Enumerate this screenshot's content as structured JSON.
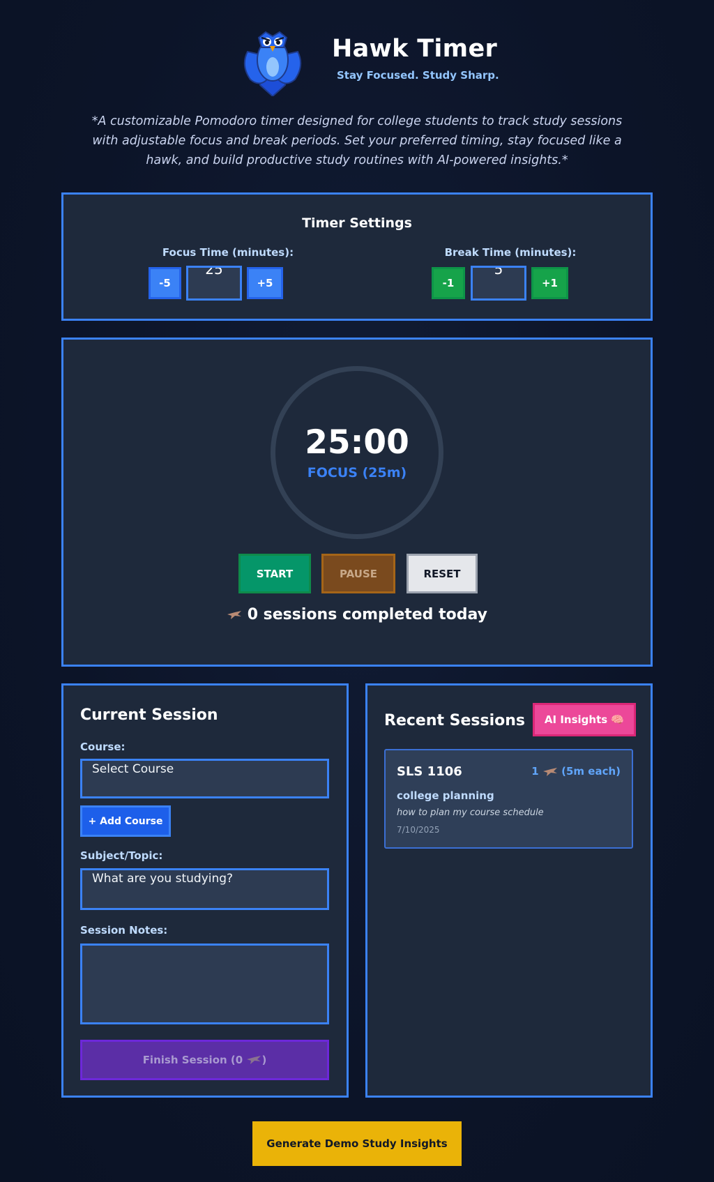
{
  "app": {
    "title": "Hawk Timer",
    "tagline": "Stay Focused. Study Sharp.",
    "intro": "*A customizable Pomodoro timer designed for college students to track study sessions with adjustable focus and break periods. Set your preferred timing, stay focused like a hawk, and build productive study routines with AI-powered insights.*"
  },
  "settings": {
    "title": "Timer Settings",
    "focus_label": "Focus Time (minutes):",
    "focus_minus": "-5",
    "focus_value": "25",
    "focus_plus": "+5",
    "break_label": "Break Time (minutes):",
    "break_minus": "-1",
    "break_value": "5",
    "break_plus": "+1"
  },
  "timer": {
    "time": "25:00",
    "mode": "FOCUS (25m)",
    "start": "START",
    "pause": "PAUSE",
    "reset": "RESET",
    "sessions_text": "0 sessions completed today"
  },
  "current_session": {
    "title": "Current Session",
    "course_label": "Course:",
    "course_placeholder": "Select Course",
    "add_course": "+ Add Course",
    "subject_label": "Subject/Topic:",
    "subject_placeholder": "What are you studying?",
    "notes_label": "Session Notes:",
    "finish_prefix": "Finish Session (0",
    "finish_suffix": ")"
  },
  "recent_sessions": {
    "title": "Recent Sessions",
    "ai_button": "AI Insights 🧠",
    "items": [
      {
        "course": "SLS 1106",
        "count_num": "1",
        "count_suffix": "(5m each)",
        "topic": "college planning",
        "note": "how to plan my course schedule",
        "date": "7/10/2025"
      }
    ]
  },
  "footer": {
    "demo_button": "Generate Demo Study Insights"
  },
  "colors": {
    "accent": "#3b82f6",
    "panel": "#1e293b",
    "green": "#059669",
    "pink": "#ec4899",
    "yellow": "#eab308",
    "purple": "#5b2ea6"
  }
}
